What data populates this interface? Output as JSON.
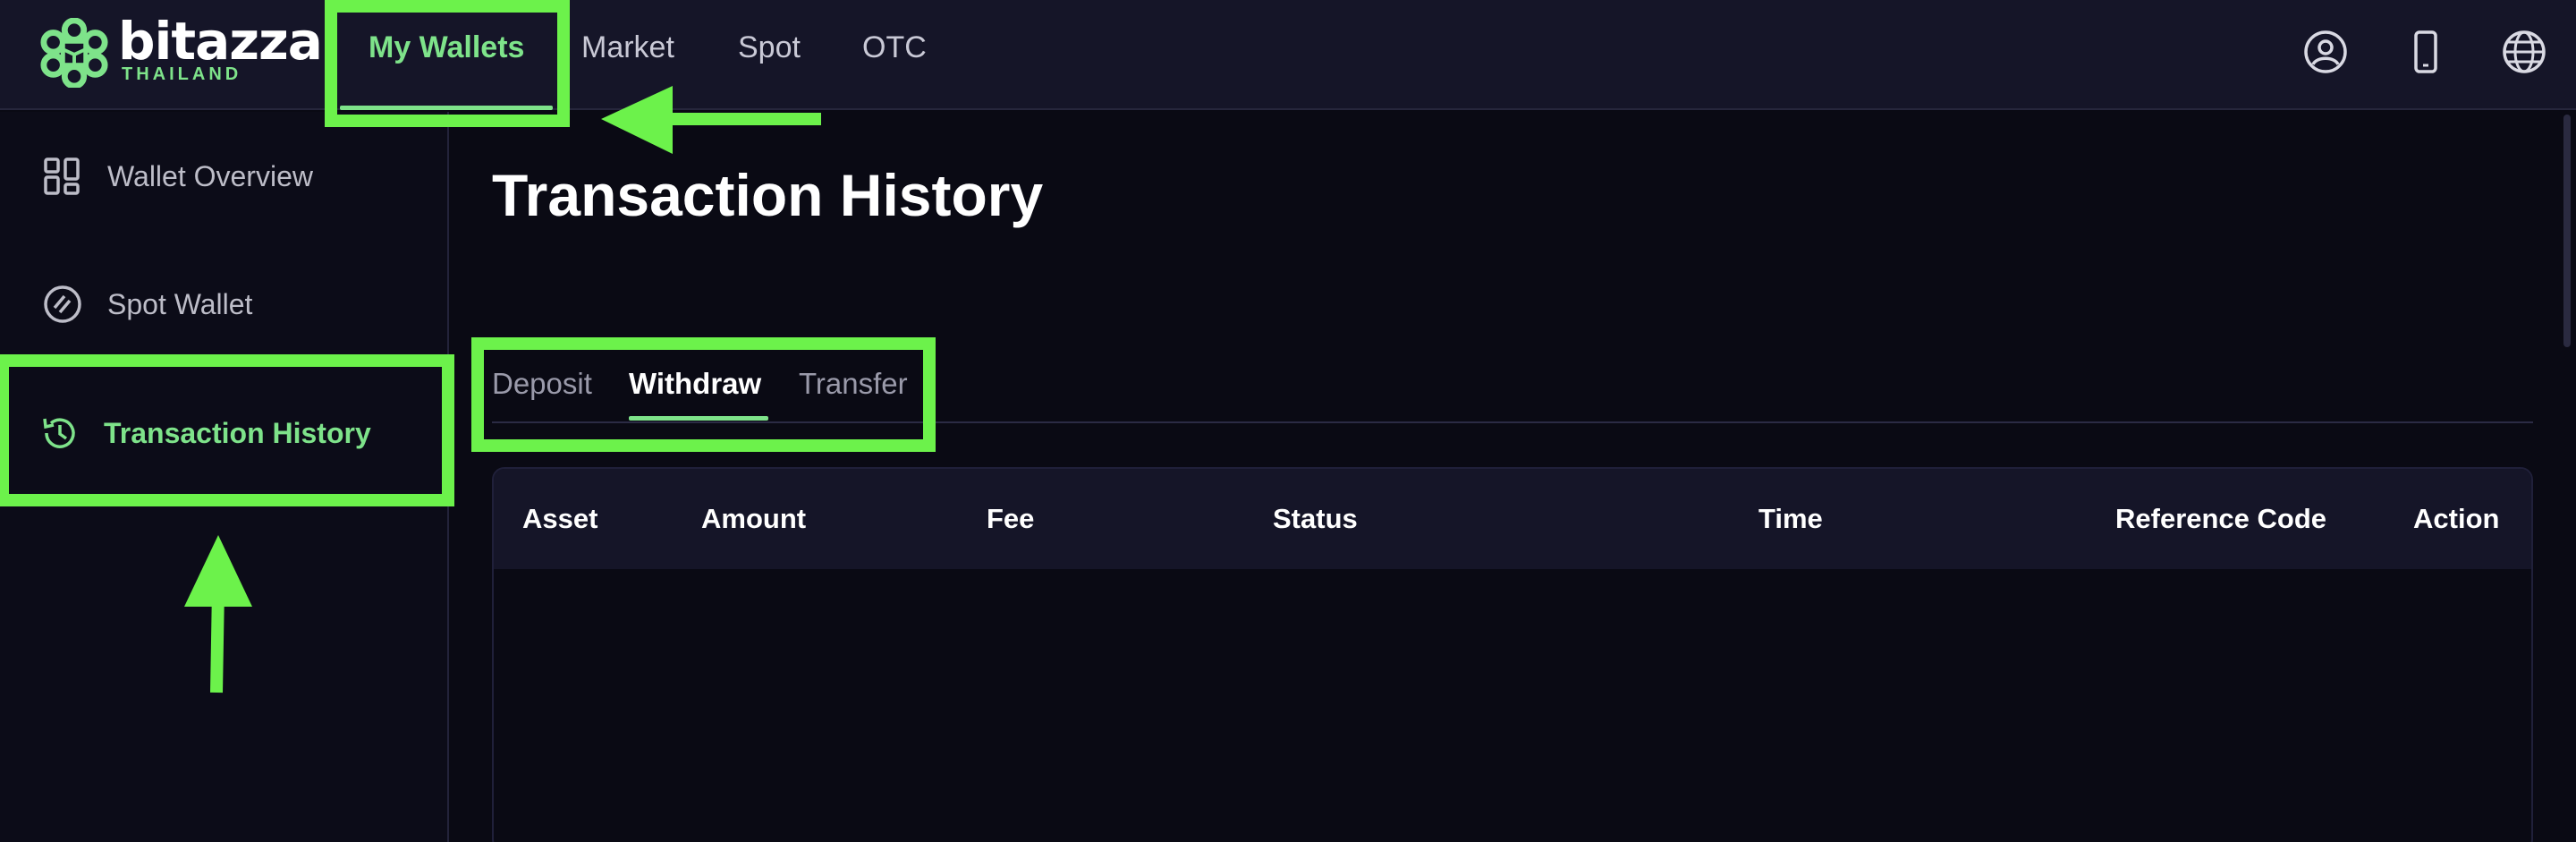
{
  "brand": {
    "name": "bitazza",
    "region": "THAILAND",
    "accent": "#7ee38a"
  },
  "topnav": {
    "items": [
      {
        "label": "My Wallets",
        "active": true
      },
      {
        "label": "Market",
        "active": false
      },
      {
        "label": "Spot",
        "active": false
      },
      {
        "label": "OTC",
        "active": false
      }
    ],
    "icons": [
      "account-icon",
      "mobile-icon",
      "globe-icon"
    ]
  },
  "sidebar": {
    "items": [
      {
        "label": "Wallet Overview",
        "icon": "grid-icon",
        "active": false
      },
      {
        "label": "Spot Wallet",
        "icon": "slash-circle-icon",
        "active": false
      },
      {
        "label": "Transaction History",
        "icon": "history-icon",
        "active": true
      }
    ]
  },
  "main": {
    "title": "Transaction History",
    "tabs": [
      {
        "label": "Deposit",
        "active": false
      },
      {
        "label": "Withdraw",
        "active": true
      },
      {
        "label": "Transfer",
        "active": false
      }
    ],
    "table": {
      "columns": [
        "Asset",
        "Amount",
        "Fee",
        "Status",
        "Time",
        "Reference Code",
        "Action"
      ],
      "rows": []
    }
  },
  "annotation": {
    "color": "#6cf24b"
  }
}
